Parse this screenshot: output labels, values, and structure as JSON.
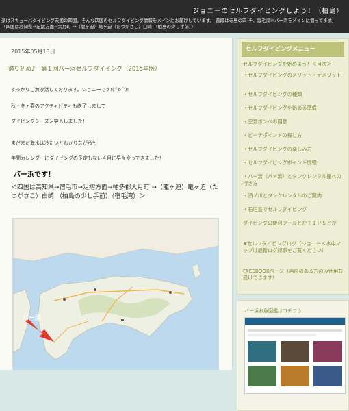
{
  "header": {
    "title": "ジョニーのセルフダイビングしよう！（柏島）",
    "desc": "楽はスキューバダイビング天国の四国。そんな四国のセルフダイビング情報をメインにお届けしています。 普段は寺島の四-チ、雷毛海inバー浜をメインに潜ってます。 〈四国は高知県→足摺方面→大月町 →（龍ヶ迫）竜ヶ迫（たつがさこ）白崎 （柏島の少し手前）〉"
  },
  "post": {
    "date": "2015年05月13日",
    "title": "潜り初め♪　第１回バー浜セルフダイイング（2015年版）",
    "paragraphs": [
      "すっかりご無沙汰しております。ジョニーです!(^o^)!",
      "秋・冬・春のアクティビティも終了しまして",
      "ダイビングシーズン突入しました！",
      "まだまだ海水は冷たいとわかりながらも",
      "年間カレンダーにダイビングの予定もない４月に早々やってきました！"
    ],
    "subheading": "バー浜です！",
    "location": "＜四国は高知県→宿毛市→足摺方面→幡多郡大月町 →（龍ヶ迫）竜ヶ迫（たつがさこ）白崎 （柏島の少し手前）（宿毛湾）＞",
    "map_label": "バー浜"
  },
  "sidebar": {
    "menu_title": "セルフダイビングメニュー",
    "items": [
      "セルフダイビングを始めよう！＜目次＞",
      "・セルフダイビングのメリット・デメリット",
      "・セルフダイビングの種類",
      "・セルフダイビングを始める準備",
      "・空気ボンベの用意",
      "・ビーチポイントの探し方",
      "・セルフダイビングの楽しみ方",
      "・セルフダイビングポイント情報",
      "・バー浜（パァ浜）とタンクレンタル屋への行き方",
      "・須ノ川とタンクレンタルのご案内",
      "・石垣島でセルフダイビング",
      "ダイビングの便利ツールとかＴＩＰＳとか",
      "★セルフダイビングログ（ジョニーｓ水中マップは最新ログ記事をご覧ください）",
      "FACEBOOKページ（画面のある方のみ使用お受けできます）"
    ],
    "gallery_title": "バー浜お魚図鑑はコチラ 》"
  },
  "colors": {
    "accent": "#7d8f3b",
    "header": "#2b2b2b",
    "sidebar_head": "#bfc27b"
  }
}
